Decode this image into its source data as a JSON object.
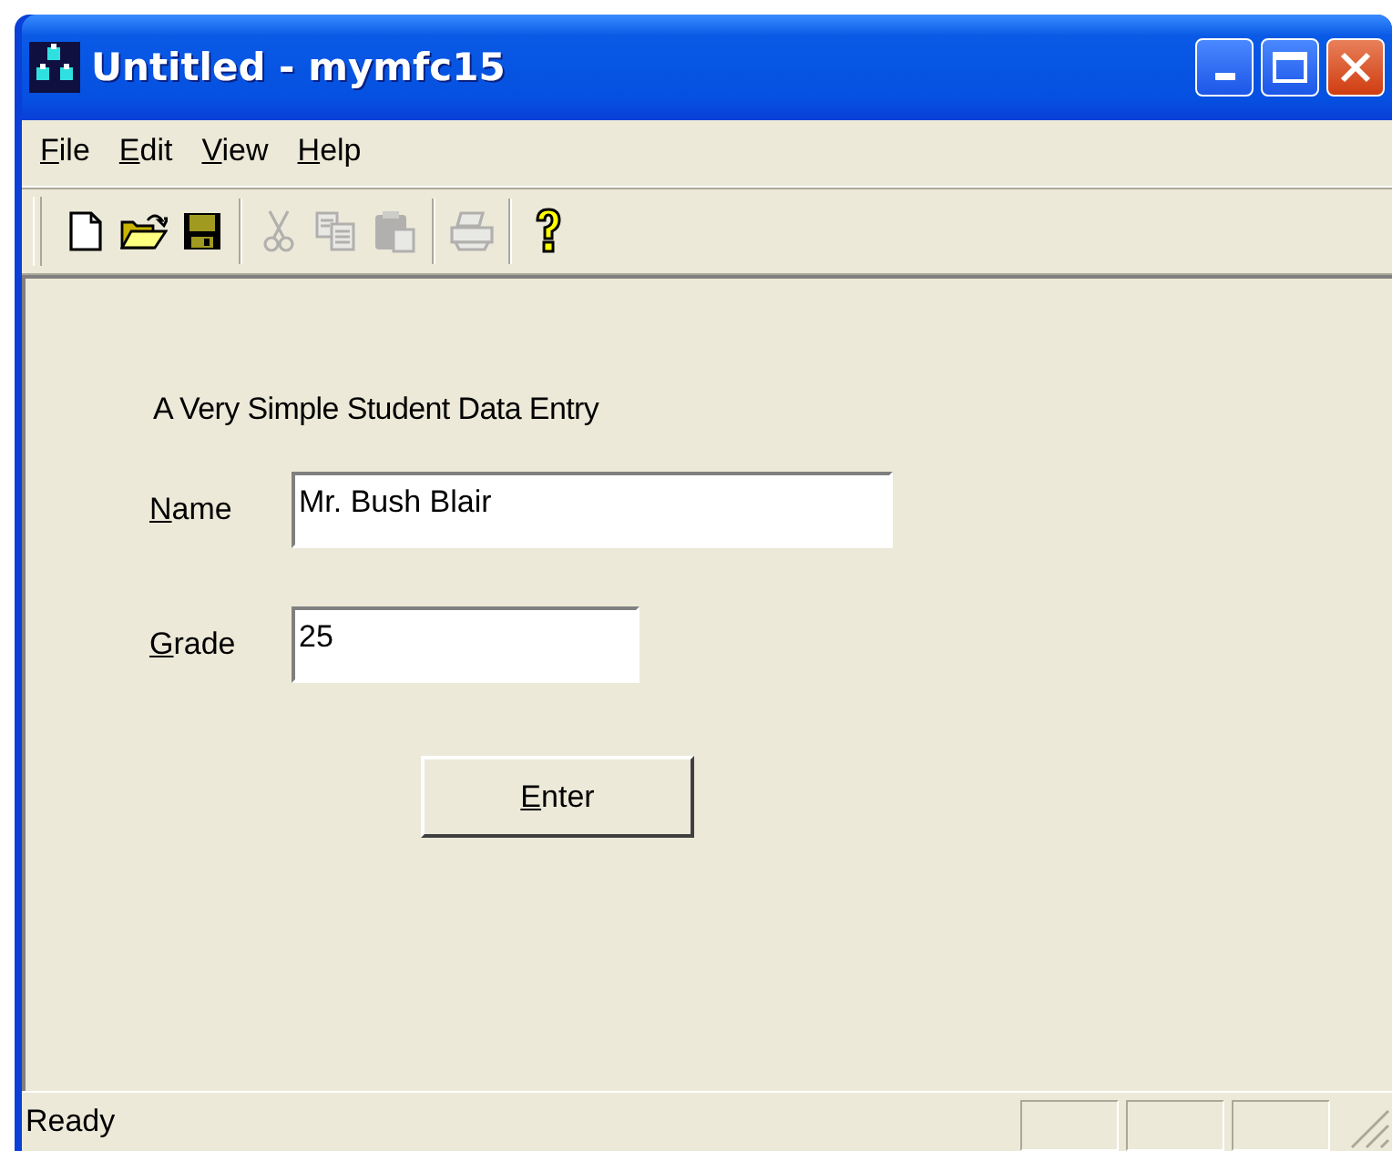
{
  "window": {
    "title": "Untitled - mymfc15"
  },
  "menu": [
    {
      "label": "File"
    },
    {
      "label": "Edit"
    },
    {
      "label": "View"
    },
    {
      "label": "Help"
    }
  ],
  "toolbar": [
    {
      "kind": "new",
      "disabled": false
    },
    {
      "kind": "open",
      "disabled": false
    },
    {
      "kind": "save",
      "disabled": false
    },
    {
      "kind": "separator"
    },
    {
      "kind": "cut",
      "disabled": true
    },
    {
      "kind": "copy",
      "disabled": true
    },
    {
      "kind": "paste",
      "disabled": true
    },
    {
      "kind": "separator"
    },
    {
      "kind": "print",
      "disabled": true
    },
    {
      "kind": "separator"
    },
    {
      "kind": "help",
      "disabled": false
    }
  ],
  "form": {
    "heading": "A Very Simple Student Data Entry",
    "fields": [
      {
        "label": "Name",
        "value": "Mr. Bush Blair",
        "kind": "wide"
      },
      {
        "label": "Grade",
        "value": "25",
        "kind": "narrow"
      }
    ],
    "button": "Enter"
  },
  "status_bar": {
    "text": "Ready"
  }
}
